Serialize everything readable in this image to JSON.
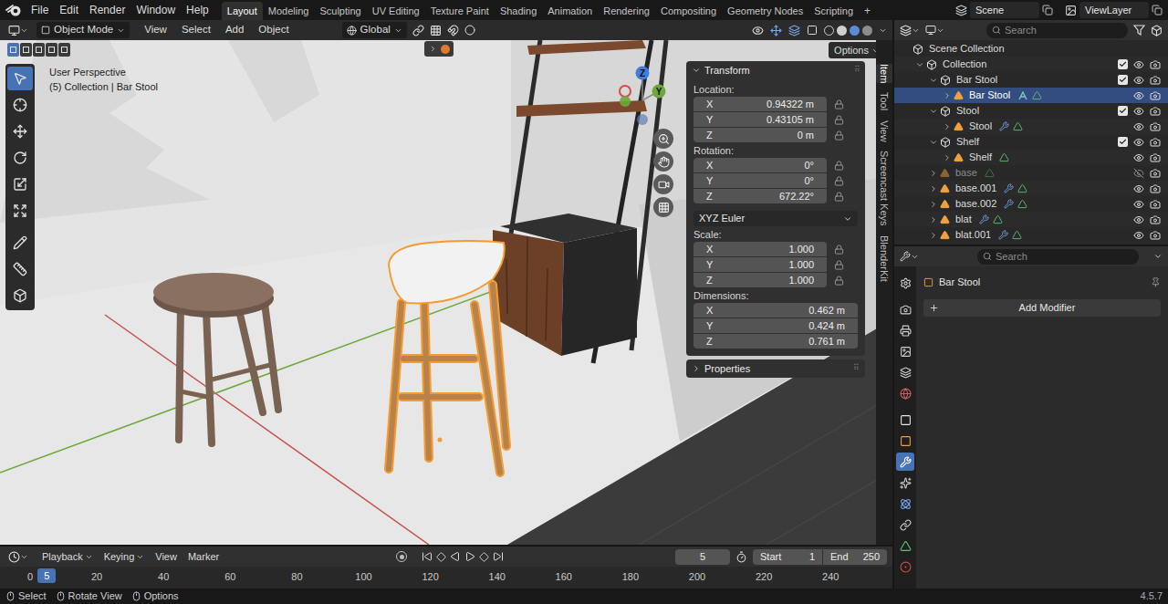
{
  "topbar": {
    "menus": [
      "File",
      "Edit",
      "Render",
      "Window",
      "Help"
    ],
    "workspaces": [
      {
        "label": "Layout",
        "selected": true
      },
      {
        "label": "Modeling",
        "selected": false
      },
      {
        "label": "Sculpting",
        "selected": false
      },
      {
        "label": "UV Editing",
        "selected": false
      },
      {
        "label": "Texture Paint",
        "selected": false
      },
      {
        "label": "Shading",
        "selected": false
      },
      {
        "label": "Animation",
        "selected": false
      },
      {
        "label": "Rendering",
        "selected": false
      },
      {
        "label": "Compositing",
        "selected": false
      },
      {
        "label": "Geometry Nodes",
        "selected": false
      },
      {
        "label": "Scripting",
        "selected": false
      }
    ],
    "add_workspace": "+",
    "scene": "Scene",
    "view_layer": "ViewLayer"
  },
  "viewport": {
    "mode": "Object Mode",
    "menus": [
      "View",
      "Select",
      "Add",
      "Object"
    ],
    "orientation": "Global",
    "options": "Options",
    "perspective": "User Perspective",
    "context": "(5) Collection | Bar Stool",
    "select_modes": [
      {
        "selected": true
      },
      {
        "selected": false
      },
      {
        "selected": false
      },
      {
        "selected": false
      },
      {
        "selected": false
      }
    ],
    "tools": [
      {
        "selected": true
      },
      {
        "selected": false
      },
      {
        "selected": false
      },
      {
        "selected": false
      },
      {
        "selected": false
      },
      {
        "selected": false
      },
      {
        "selected": false
      },
      {
        "selected": false
      },
      {
        "selected": false
      }
    ],
    "gizmo_labels": [
      "Z",
      "Y"
    ]
  },
  "sidebar": {
    "tabs": [
      {
        "label": "Item",
        "selected": true
      },
      {
        "label": "Tool",
        "selected": false
      },
      {
        "label": "View",
        "selected": false
      },
      {
        "label": "Screencast Keys",
        "selected": false
      },
      {
        "label": "BlenderKit",
        "selected": false
      }
    ],
    "panel": {
      "title": "Transform",
      "expanded": true
    },
    "groups": [
      {
        "label": "Location:",
        "fields": [
          {
            "axis": "X",
            "value": "0.94322 m",
            "locked": false
          },
          {
            "axis": "Y",
            "value": "0.43105 m",
            "locked": false
          },
          {
            "axis": "Z",
            "value": "0 m",
            "locked": false
          }
        ]
      },
      {
        "label": "Rotation:",
        "fields": [
          {
            "axis": "X",
            "value": "0°",
            "locked": false
          },
          {
            "axis": "Y",
            "value": "0°",
            "locked": false
          },
          {
            "axis": "Z",
            "value": "672.22°",
            "locked": false
          }
        ]
      },
      {
        "label": "Scale:",
        "fields": [
          {
            "axis": "X",
            "value": "1.000",
            "locked": false
          },
          {
            "axis": "Y",
            "value": "1.000",
            "locked": false
          },
          {
            "axis": "Z",
            "value": "1.000",
            "locked": false
          }
        ]
      },
      {
        "label": "Dimensions:",
        "fields": [
          {
            "axis": "X",
            "value": "0.462 m"
          },
          {
            "axis": "Y",
            "value": "0.424 m"
          },
          {
            "axis": "Z",
            "value": "0.761 m"
          }
        ]
      }
    ],
    "rotation_mode": "XYZ Euler",
    "subpanel": {
      "title": "Properties",
      "expanded": false
    }
  },
  "timeline": {
    "menus": [
      {
        "label": "Playback",
        "dropdown": true
      },
      {
        "label": "Keying",
        "dropdown": true
      },
      {
        "label": "View",
        "dropdown": false
      },
      {
        "label": "Marker",
        "dropdown": false
      }
    ],
    "current_frame": "5",
    "start_label": "Start",
    "start": "1",
    "end_label": "End",
    "end": "250",
    "ticks": [
      "0",
      "20",
      "40",
      "60",
      "80",
      "100",
      "120",
      "140",
      "160",
      "180",
      "200",
      "220",
      "240"
    ]
  },
  "outliner": {
    "search": "Search",
    "rows": [
      {
        "name": "Scene Collection",
        "depth": 0,
        "kind": "scene",
        "selected": false,
        "badges": []
      },
      {
        "name": "Collection",
        "depth": 1,
        "kind": "collection",
        "expanded": true,
        "checked": true,
        "visible": true,
        "selected": false,
        "badges": []
      },
      {
        "name": "Bar Stool",
        "depth": 2,
        "kind": "collection",
        "expanded": true,
        "checked": true,
        "visible": true,
        "selected": false,
        "badges": []
      },
      {
        "name": "Bar Stool",
        "depth": 3,
        "kind": "object",
        "expanded": false,
        "visible": true,
        "selected": true,
        "badges": [
          "geonodes",
          "mesh"
        ]
      },
      {
        "name": "Stool",
        "depth": 2,
        "kind": "collection",
        "expanded": true,
        "checked": true,
        "visible": true,
        "selected": false,
        "badges": []
      },
      {
        "name": "Stool",
        "depth": 3,
        "kind": "object",
        "expanded": false,
        "visible": true,
        "selected": false,
        "badges": [
          "wrench",
          "mesh"
        ]
      },
      {
        "name": "Shelf",
        "depth": 2,
        "kind": "collection",
        "expanded": true,
        "checked": true,
        "visible": true,
        "selected": false,
        "badges": []
      },
      {
        "name": "Shelf",
        "depth": 3,
        "kind": "object",
        "expanded": false,
        "visible": true,
        "selected": false,
        "badges": [
          "mesh"
        ]
      },
      {
        "name": "base",
        "depth": 2,
        "kind": "object",
        "expanded": false,
        "visible": false,
        "selected": false,
        "badges": [
          "mesh"
        ]
      },
      {
        "name": "base.001",
        "depth": 2,
        "kind": "object",
        "expanded": false,
        "visible": true,
        "selected": false,
        "badges": [
          "wrench",
          "mesh"
        ]
      },
      {
        "name": "base.002",
        "depth": 2,
        "kind": "object",
        "expanded": false,
        "visible": true,
        "selected": false,
        "badges": [
          "wrench",
          "mesh"
        ]
      },
      {
        "name": "blat",
        "depth": 2,
        "kind": "object",
        "expanded": false,
        "visible": true,
        "selected": false,
        "badges": [
          "wrench",
          "mesh"
        ]
      },
      {
        "name": "blat.001",
        "depth": 2,
        "kind": "object",
        "expanded": false,
        "visible": true,
        "selected": false,
        "badges": [
          "wrench",
          "mesh"
        ]
      }
    ]
  },
  "properties": {
    "search": "Search",
    "object": "Bar Stool",
    "add_modifier": "Add Modifier",
    "tabs": [
      {
        "selected": false
      },
      {
        "selected": false
      },
      {
        "selected": false
      },
      {
        "selected": false
      },
      {
        "selected": false
      },
      {
        "selected": false
      },
      {
        "selected": false
      },
      {
        "selected": false
      },
      {
        "selected": true
      },
      {
        "selected": false
      },
      {
        "selected": false
      },
      {
        "selected": false
      },
      {
        "selected": false
      },
      {
        "selected": false
      }
    ]
  },
  "status_bar": {
    "items": [
      {
        "label": "Select"
      },
      {
        "label": "Rotate View"
      },
      {
        "label": "Options"
      }
    ],
    "version": "4.5.7"
  }
}
